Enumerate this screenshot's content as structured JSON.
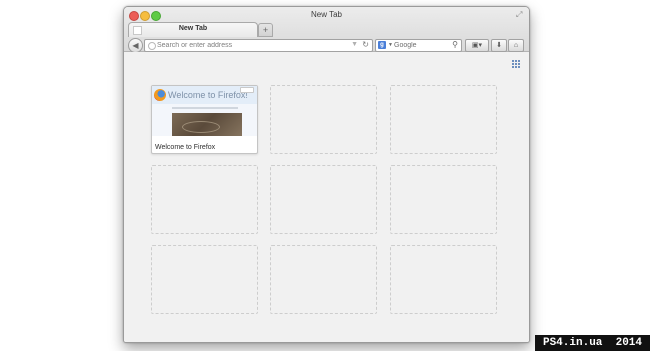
{
  "window": {
    "title": "New Tab"
  },
  "tabs": [
    {
      "label": "New Tab",
      "active": true
    }
  ],
  "new_tab_button": {
    "label": "+"
  },
  "navbar": {
    "back_icon": "back-arrow-icon",
    "url_placeholder": "Search or enter address",
    "url_value": "",
    "search_engine": "Google",
    "search_placeholder": "Google"
  },
  "content": {
    "tiles": [
      {
        "title": "Welcome to Firefox",
        "thumbnail_title": "Welcome to Firefox!",
        "filled": true
      },
      {
        "title": "",
        "filled": false
      },
      {
        "title": "",
        "filled": false
      },
      {
        "title": "",
        "filled": false
      },
      {
        "title": "",
        "filled": false
      },
      {
        "title": "",
        "filled": false
      },
      {
        "title": "",
        "filled": false
      },
      {
        "title": "",
        "filled": false
      },
      {
        "title": "",
        "filled": false
      }
    ]
  },
  "watermark": "PS4.in.ua  2014",
  "colors": {
    "close": "#ec5c56",
    "minimize": "#f6bd3f",
    "maximize": "#5fcb45",
    "google_blue": "#4b7fd8"
  }
}
